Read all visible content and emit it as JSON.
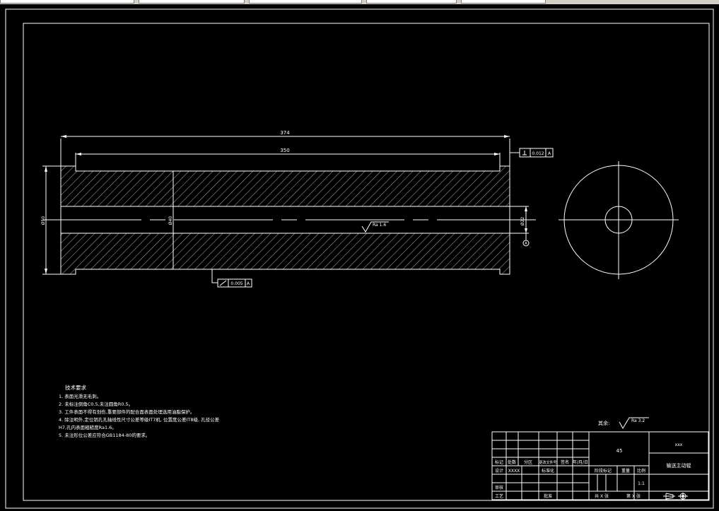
{
  "dimensions": {
    "overall_length": "374",
    "inner_length": "350",
    "outer_diameter": "Ø50",
    "center_diameter": "Ø40",
    "bore_diameter": "Ø22"
  },
  "tolerances": {
    "top_frame_value": "0.012",
    "top_frame_datum": "A",
    "bottom_frame_value": "0.005",
    "bottom_frame_datum": "A",
    "datum_label": "A"
  },
  "roughness": {
    "bore": "Ra 1.6",
    "rest_prefix": "其余:",
    "rest": "Ra 3.2"
  },
  "tech_requirements": {
    "title": "技术要求",
    "items": [
      "1. 表面光滑无毛刺。",
      "2. 未标注倒角C0.5,未注圆角R0.5。",
      "3. 工件表面不得有划伤,重要部件的配合面表面处理选用油脂保护。",
      "4. 除注明外,定位销孔孔轴线性尺寸公差等级IT7机, 位置度公差IT8级, 孔径公差",
      "H7,孔内表面粗糙度Ra1.6。",
      "5. 未注形位公差应符合GB1184-80的要求。"
    ]
  },
  "title_block": {
    "material": "45",
    "company": "xxx",
    "part_name": "输送主动辊",
    "header_cells": [
      "标记",
      "处数",
      "分区",
      "更改文件号",
      "签名",
      "年/月/日"
    ],
    "designer_label": "设计",
    "designer_value": "XXXX",
    "standard_label": "标准化",
    "review_label": "审核",
    "process_label": "工艺",
    "approve_label": "批准",
    "stage_label": "阶段标记",
    "weight_label": "重量",
    "scale_label": "比例",
    "scale_value": "1:1",
    "sheets_total": "共 X 张",
    "sheet_number": "第 X 张"
  },
  "colors": {
    "background": "#000000",
    "lines": "#ffffff"
  }
}
